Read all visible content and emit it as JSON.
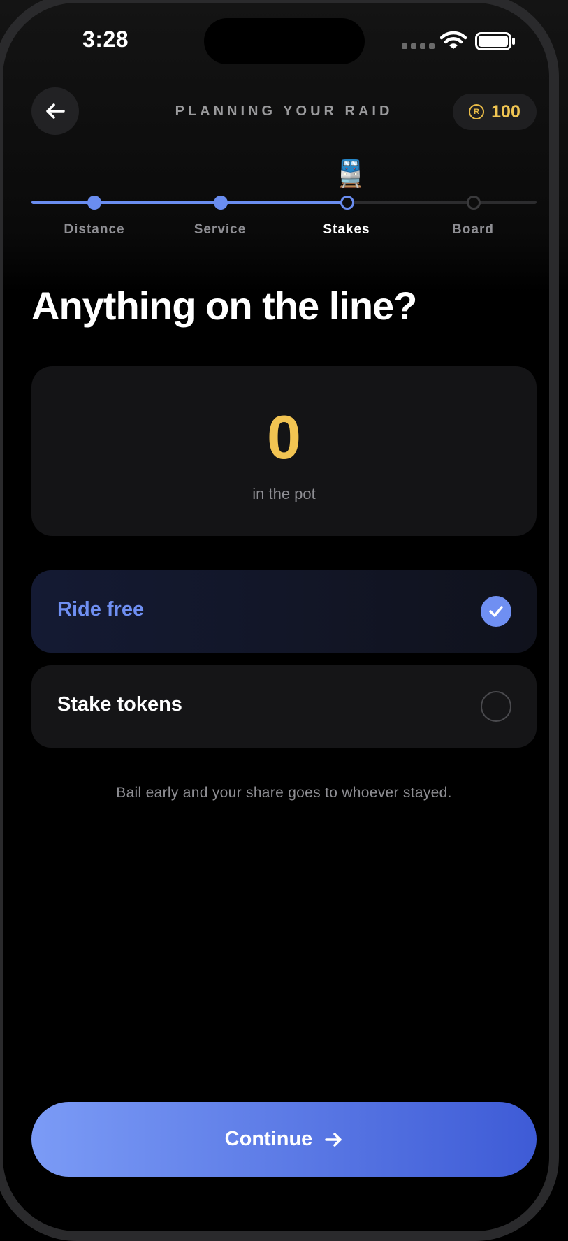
{
  "status_bar": {
    "time": "3:28"
  },
  "header": {
    "title": "PLANNING YOUR RAID",
    "token_balance": "100",
    "coin_symbol": "R"
  },
  "progress": {
    "steps": [
      {
        "label": "Distance",
        "state": "done"
      },
      {
        "label": "Service",
        "state": "done"
      },
      {
        "label": "Stakes",
        "state": "current"
      },
      {
        "label": "Board",
        "state": "todo"
      }
    ],
    "current_icon": "train-icon"
  },
  "main": {
    "title": "Anything on the line?",
    "pot": {
      "amount": "0",
      "label": "in the pot"
    },
    "options": [
      {
        "label": "Ride free",
        "selected": true
      },
      {
        "label": "Stake tokens",
        "selected": false
      }
    ],
    "hint": "Bail early and your share goes to whoever stayed."
  },
  "footer": {
    "continue_label": "Continue"
  },
  "colors": {
    "accent": "#6f8ff2",
    "gold": "#f2c452",
    "background": "#000000"
  }
}
